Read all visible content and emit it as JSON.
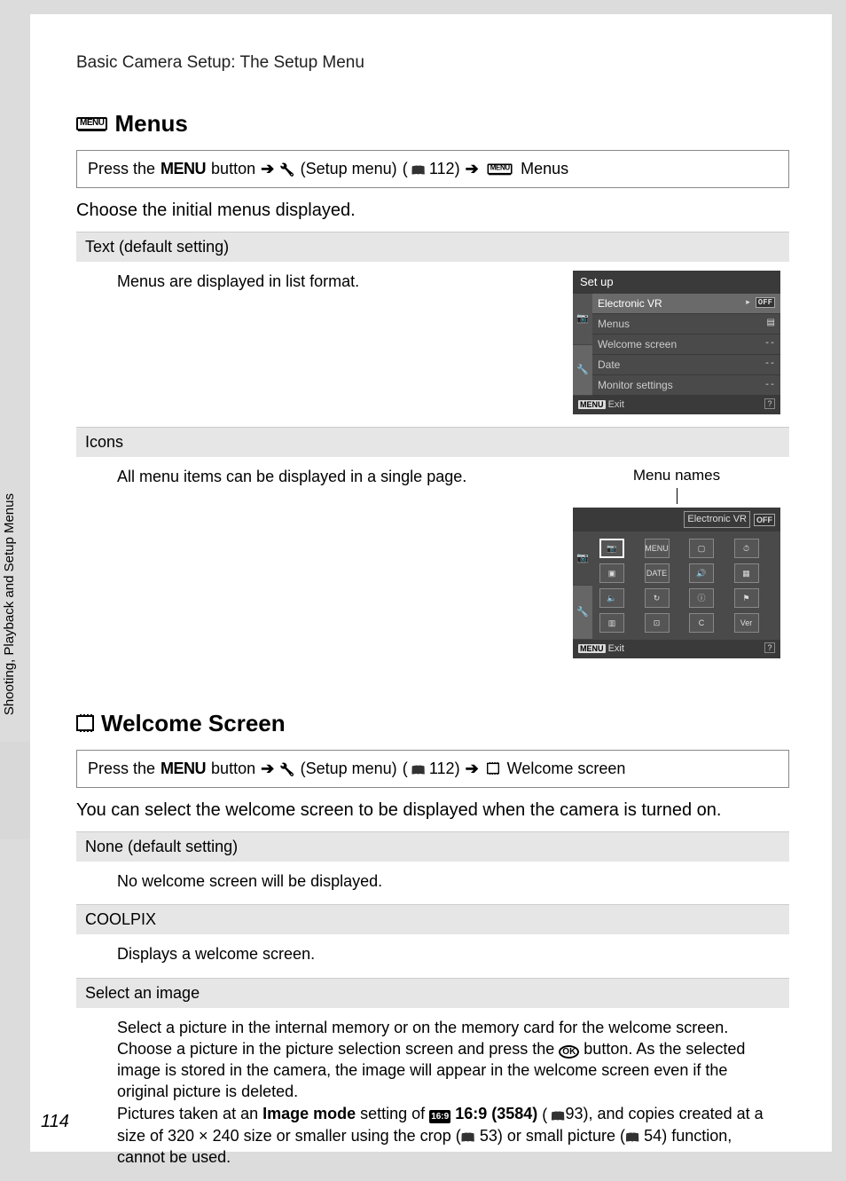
{
  "breadcrumb": "Basic Camera Setup: The Setup Menu",
  "side_label": "Shooting, Playback and Setup Menus",
  "page_number": "114",
  "section1": {
    "title": "Menus",
    "nav": {
      "prefix": "Press the",
      "menu_word": "MENU",
      "button_word": "button",
      "setup_label": "(Setup menu)",
      "page_ref": "112)",
      "tail": "Menus"
    },
    "intro": "Choose the initial menus displayed.",
    "opt1": {
      "header": "Text (default setting)",
      "body": "Menus are displayed in list format."
    },
    "opt2": {
      "header": "Icons",
      "body": "All menu items can be displayed in a single page.",
      "menu_names": "Menu names"
    }
  },
  "lcd1": {
    "title": "Set up",
    "items": [
      {
        "label": "Electronic VR",
        "right": "OFF",
        "hi": true
      },
      {
        "label": "Menus",
        "right": "▤"
      },
      {
        "label": "Welcome screen",
        "right": "--"
      },
      {
        "label": "Date",
        "right": "--"
      },
      {
        "label": "Monitor settings",
        "right": "--"
      }
    ],
    "foot_menu": "MENU",
    "foot_exit": "Exit"
  },
  "lcd2": {
    "selected": "Electronic VR",
    "off": "OFF",
    "cells": [
      "📷",
      "MENU",
      "▢",
      "⏱",
      "▣",
      "DATE",
      "🔊",
      "▦",
      "🔈",
      "↻",
      "ⓘ",
      "⚑",
      "▥",
      "⊡",
      "C",
      "Ver"
    ],
    "foot_menu": "MENU",
    "foot_exit": "Exit"
  },
  "section2": {
    "title": "Welcome Screen",
    "nav": {
      "prefix": "Press the",
      "menu_word": "MENU",
      "button_word": "button",
      "setup_label": "(Setup menu)",
      "page_ref": "112)",
      "tail": "Welcome screen"
    },
    "intro": "You can select the welcome screen to be displayed when the camera is turned on.",
    "opt1": {
      "header": "None (default setting)",
      "body": "No welcome screen will be displayed."
    },
    "opt2": {
      "header": "COOLPIX",
      "body": "Displays a welcome screen."
    },
    "opt3": {
      "header": "Select an image",
      "p1a": "Select a picture in the internal memory or on the memory card for the welcome screen. Choose a picture in the picture selection screen and press the ",
      "p1b": " button. As the selected image is stored in the camera, the image will appear in the welcome screen even if the original picture is deleted.",
      "p2a": "Pictures taken at an ",
      "p2bold": "Image mode",
      "p2b": " setting of ",
      "p2ratio": "16:9 (3584)",
      "p2ref1": "93), and copies created at a size of 320 × 240 size or smaller using the crop (",
      "p2ref2": "53) or small picture (",
      "p2ref3": "54) function, cannot be used."
    }
  }
}
